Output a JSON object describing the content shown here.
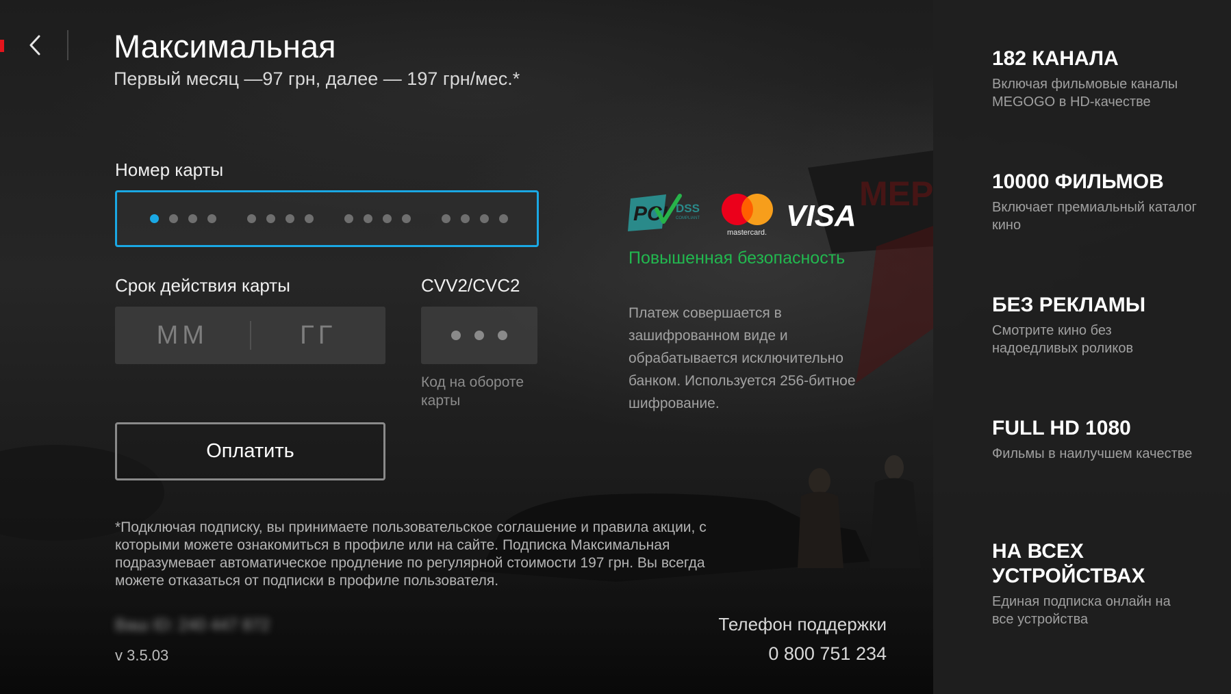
{
  "header": {
    "title": "Максимальная",
    "subtitle": "Первый месяц —97 грн, далее — 197 грн/мес.*"
  },
  "form": {
    "card_number_label": "Номер карты",
    "card_number_groups": 4,
    "card_number_digits_per_group": 4,
    "expiry_label": "Срок действия карты",
    "expiry_month_placeholder": "ММ",
    "expiry_year_placeholder": "ГГ",
    "cvv_label": "CVV2/CVC2",
    "cvv_hint": "Код на обороте карты",
    "pay_button": "Оплатить"
  },
  "security": {
    "logos": [
      "pci-dss-logo",
      "mastercard-logo",
      "visa-logo"
    ],
    "badge_text": "Повышенная безопасность",
    "description": "Платеж совершается в зашифрованном виде и обрабатывается исключительно банком. Используется 256-битное шифрование."
  },
  "disclaimer": "*Подключая подписку, вы принимаете пользовательское соглашение и правила акции, с которыми можете ознакомиться в профиле или на сайте. Подписка Максимальная подразумевает автоматическое продление по регулярной стоимости 197 грн. Вы всегда можете отказаться от подписки в профиле пользователя.",
  "footer": {
    "blurred_id": "Ваш ID: 240 447 872",
    "version": "v 3.5.03",
    "support_label": "Телефон поддержки",
    "support_phone": "0 800 751 234"
  },
  "features": [
    {
      "title": "182 КАНАЛА",
      "description": "Включая фильмовые каналы MEGOGO в HD-качестве"
    },
    {
      "title": "10000 ФИЛЬМОВ",
      "description": "Включает премиальный каталог кино"
    },
    {
      "title": "БЕЗ РЕКЛАМЫ",
      "description": "Смотрите кино без надоедливых роликов"
    },
    {
      "title": "FULL HD 1080",
      "description": "Фильмы в наилучшем качестве"
    },
    {
      "title": "НА ВСЕХ УСТРОЙСТВАХ",
      "description": "Единая подписка онлайн на все устройства"
    }
  ],
  "colors": {
    "accent": "#1aa8e4",
    "security_green": "#22b84f",
    "brand_red": "#e4141c"
  }
}
